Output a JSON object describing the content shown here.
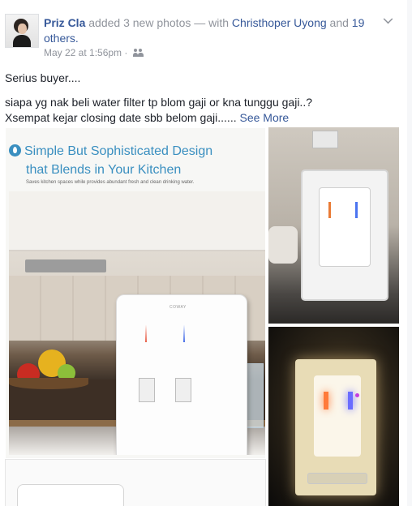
{
  "post": {
    "author": "Priz Cla",
    "action": "added 3 new photos — with",
    "tagged_person": "Christhoper Uyong",
    "and_text": "and",
    "others": "19 others.",
    "timestamp": "May 22 at 1:56pm",
    "separator": "·",
    "audience_icon": "friends-icon",
    "options_icon": "chevron-down-icon",
    "text_line1": "Serius buyer....",
    "text_line2": "siapa yg nak beli water filter tp blom gaji or kna tunggu gaji..?",
    "text_line3": "Xsempat kejar closing date sbb belom gaji......",
    "see_more": "See More"
  },
  "photos": {
    "main": {
      "headline": "Simple But Sophisticated Design",
      "subhead": "that Blends in Your Kitchen",
      "tagline": "Saves kitchen spaces while provides abundant fresh and clean drinking water.",
      "brand": "COWAY"
    }
  },
  "colors": {
    "link": "#365899",
    "meta": "#90949c",
    "body_text": "#1d2129",
    "ad_blue": "#3a8fc0"
  }
}
